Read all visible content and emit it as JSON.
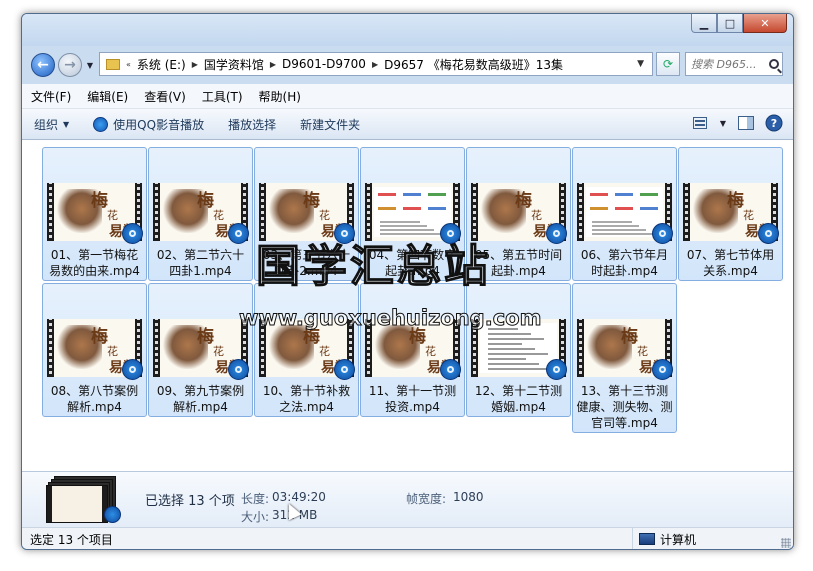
{
  "window": {
    "minimize_glyph": "▁",
    "maximize_glyph": "□",
    "close_glyph": "✕"
  },
  "nav": {
    "back_glyph": "←",
    "forward_glyph": "→",
    "history_glyph": "▼",
    "refresh_glyph": "⟳",
    "address": {
      "overflow": "«",
      "separator": "▶",
      "dropdown": "▼",
      "segments": [
        "系统 (E:)",
        "国学资料馆",
        "D9601-D9700",
        "D9657 《梅花易数高级班》13集"
      ]
    },
    "search_placeholder": "搜索 D965..."
  },
  "menu": [
    "文件(F)",
    "编辑(E)",
    "查看(V)",
    "工具(T)",
    "帮助(H)"
  ],
  "toolbar": {
    "organize": "组织",
    "qq_play": "使用QQ影音播放",
    "play_selection": "播放选择",
    "new_folder": "新建文件夹",
    "caret": "▼",
    "help_glyph": "?"
  },
  "thumb_text": {
    "c1": "梅",
    "c2": "花",
    "c3": "易数"
  },
  "files": [
    {
      "name": "01、第一节梅花易数的由来.mp4",
      "thumb": "cover"
    },
    {
      "name": "02、第二节六十四卦1.mp4",
      "thumb": "cover"
    },
    {
      "name": "03、第三节六十四卦2.mp4",
      "thumb": "cover"
    },
    {
      "name": "04、第四节数字起卦.mp4",
      "thumb": "table"
    },
    {
      "name": "05、第五节时间起卦.mp4",
      "thumb": "cover"
    },
    {
      "name": "06、第六节年月时起卦.mp4",
      "thumb": "table"
    },
    {
      "name": "07、第七节体用关系.mp4",
      "thumb": "cover"
    },
    {
      "name": "08、第八节案例解析.mp4",
      "thumb": "cover"
    },
    {
      "name": "09、第九节案例解析.mp4",
      "thumb": "cover"
    },
    {
      "name": "10、第十节补救之法.mp4",
      "thumb": "cover"
    },
    {
      "name": "11、第十一节测投资.mp4",
      "thumb": "cover"
    },
    {
      "name": "12、第十二节测婚姻.mp4",
      "thumb": "text"
    },
    {
      "name": "13、第十三节测健康、测失物、测官司等.mp4",
      "thumb": "cover"
    }
  ],
  "details": {
    "selected": "已选择 13 个项",
    "length_label": "长度:",
    "length_value": "03:49:20",
    "size_label": "大小:",
    "size_value": "312 MB",
    "frame_width_label": "帧宽度:",
    "frame_width_value": "1080"
  },
  "status": {
    "left": "选定 13 个项目",
    "right": "计算机"
  },
  "watermark": {
    "cn": "国学汇总站",
    "url": "www.guoxuehuizong.com"
  }
}
